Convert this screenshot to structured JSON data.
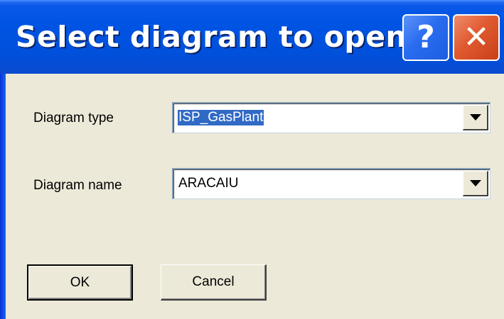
{
  "window": {
    "title": "Select diagram to open",
    "help_glyph": "?",
    "close_glyph": "✕"
  },
  "form": {
    "diagram_type_label": "Diagram type",
    "diagram_type_value": "ISP_GasPlant",
    "diagram_name_label": "Diagram name",
    "diagram_name_value": "ARACAIU"
  },
  "buttons": {
    "ok_label": "OK",
    "cancel_label": "Cancel"
  },
  "colors": {
    "titlebar": "#0054e3",
    "close_button": "#e05a30",
    "dialog_background": "#ece9d8",
    "selection_highlight": "#316ac5"
  },
  "icons": {
    "help": "help-icon",
    "close": "close-icon",
    "dropdown": "chevron-down-icon"
  }
}
